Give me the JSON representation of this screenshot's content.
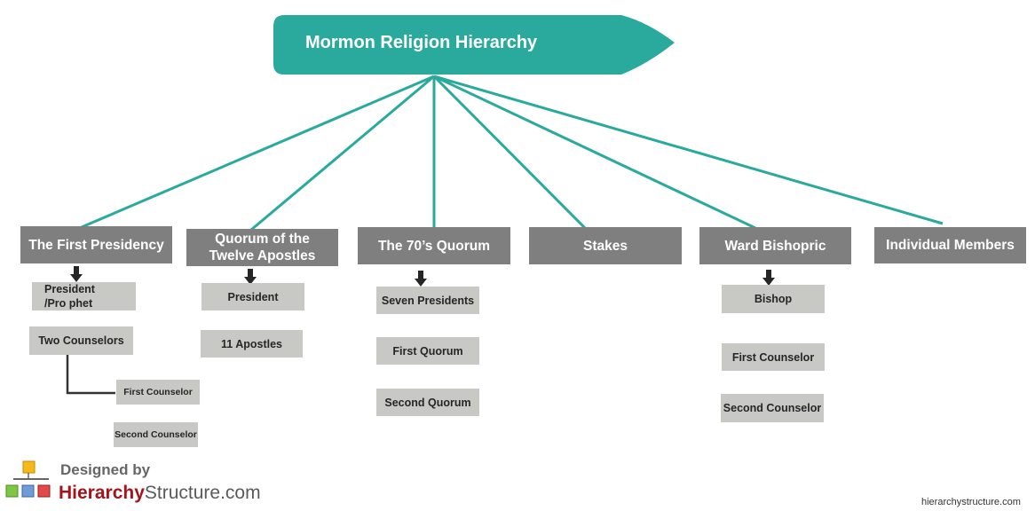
{
  "title": "Mormon Religion Hierarchy",
  "colors": {
    "root_fill": "#2aaa9c",
    "connector": "#2aaa9c",
    "header_fill": "#7f7f7f",
    "sub_fill": "#c8c8c4",
    "arrow": "#262626"
  },
  "branches": [
    {
      "label": "The First Presidency",
      "children": [
        "President /Pro phet",
        "Two Counselors"
      ],
      "grandchildren": [
        "First Counselor",
        "Second Counselor"
      ]
    },
    {
      "label": "Quorum of the Twelve Apostles",
      "children": [
        "President",
        "11 Apostles"
      ]
    },
    {
      "label": "The 70’s Quorum",
      "children": [
        "Seven Presidents",
        "First Quorum",
        "Second Quorum"
      ]
    },
    {
      "label": "Stakes",
      "children": []
    },
    {
      "label": "Ward Bishopric",
      "children": [
        "Bishop",
        "First Counselor",
        "Second Counselor"
      ]
    },
    {
      "label": "Individual Members",
      "children": []
    }
  ],
  "branding": {
    "designed_by": "Designed by",
    "brand_bold": "Hierarchy",
    "brand_rest": "Structure.com",
    "credit": "hierarchystructure.com"
  }
}
